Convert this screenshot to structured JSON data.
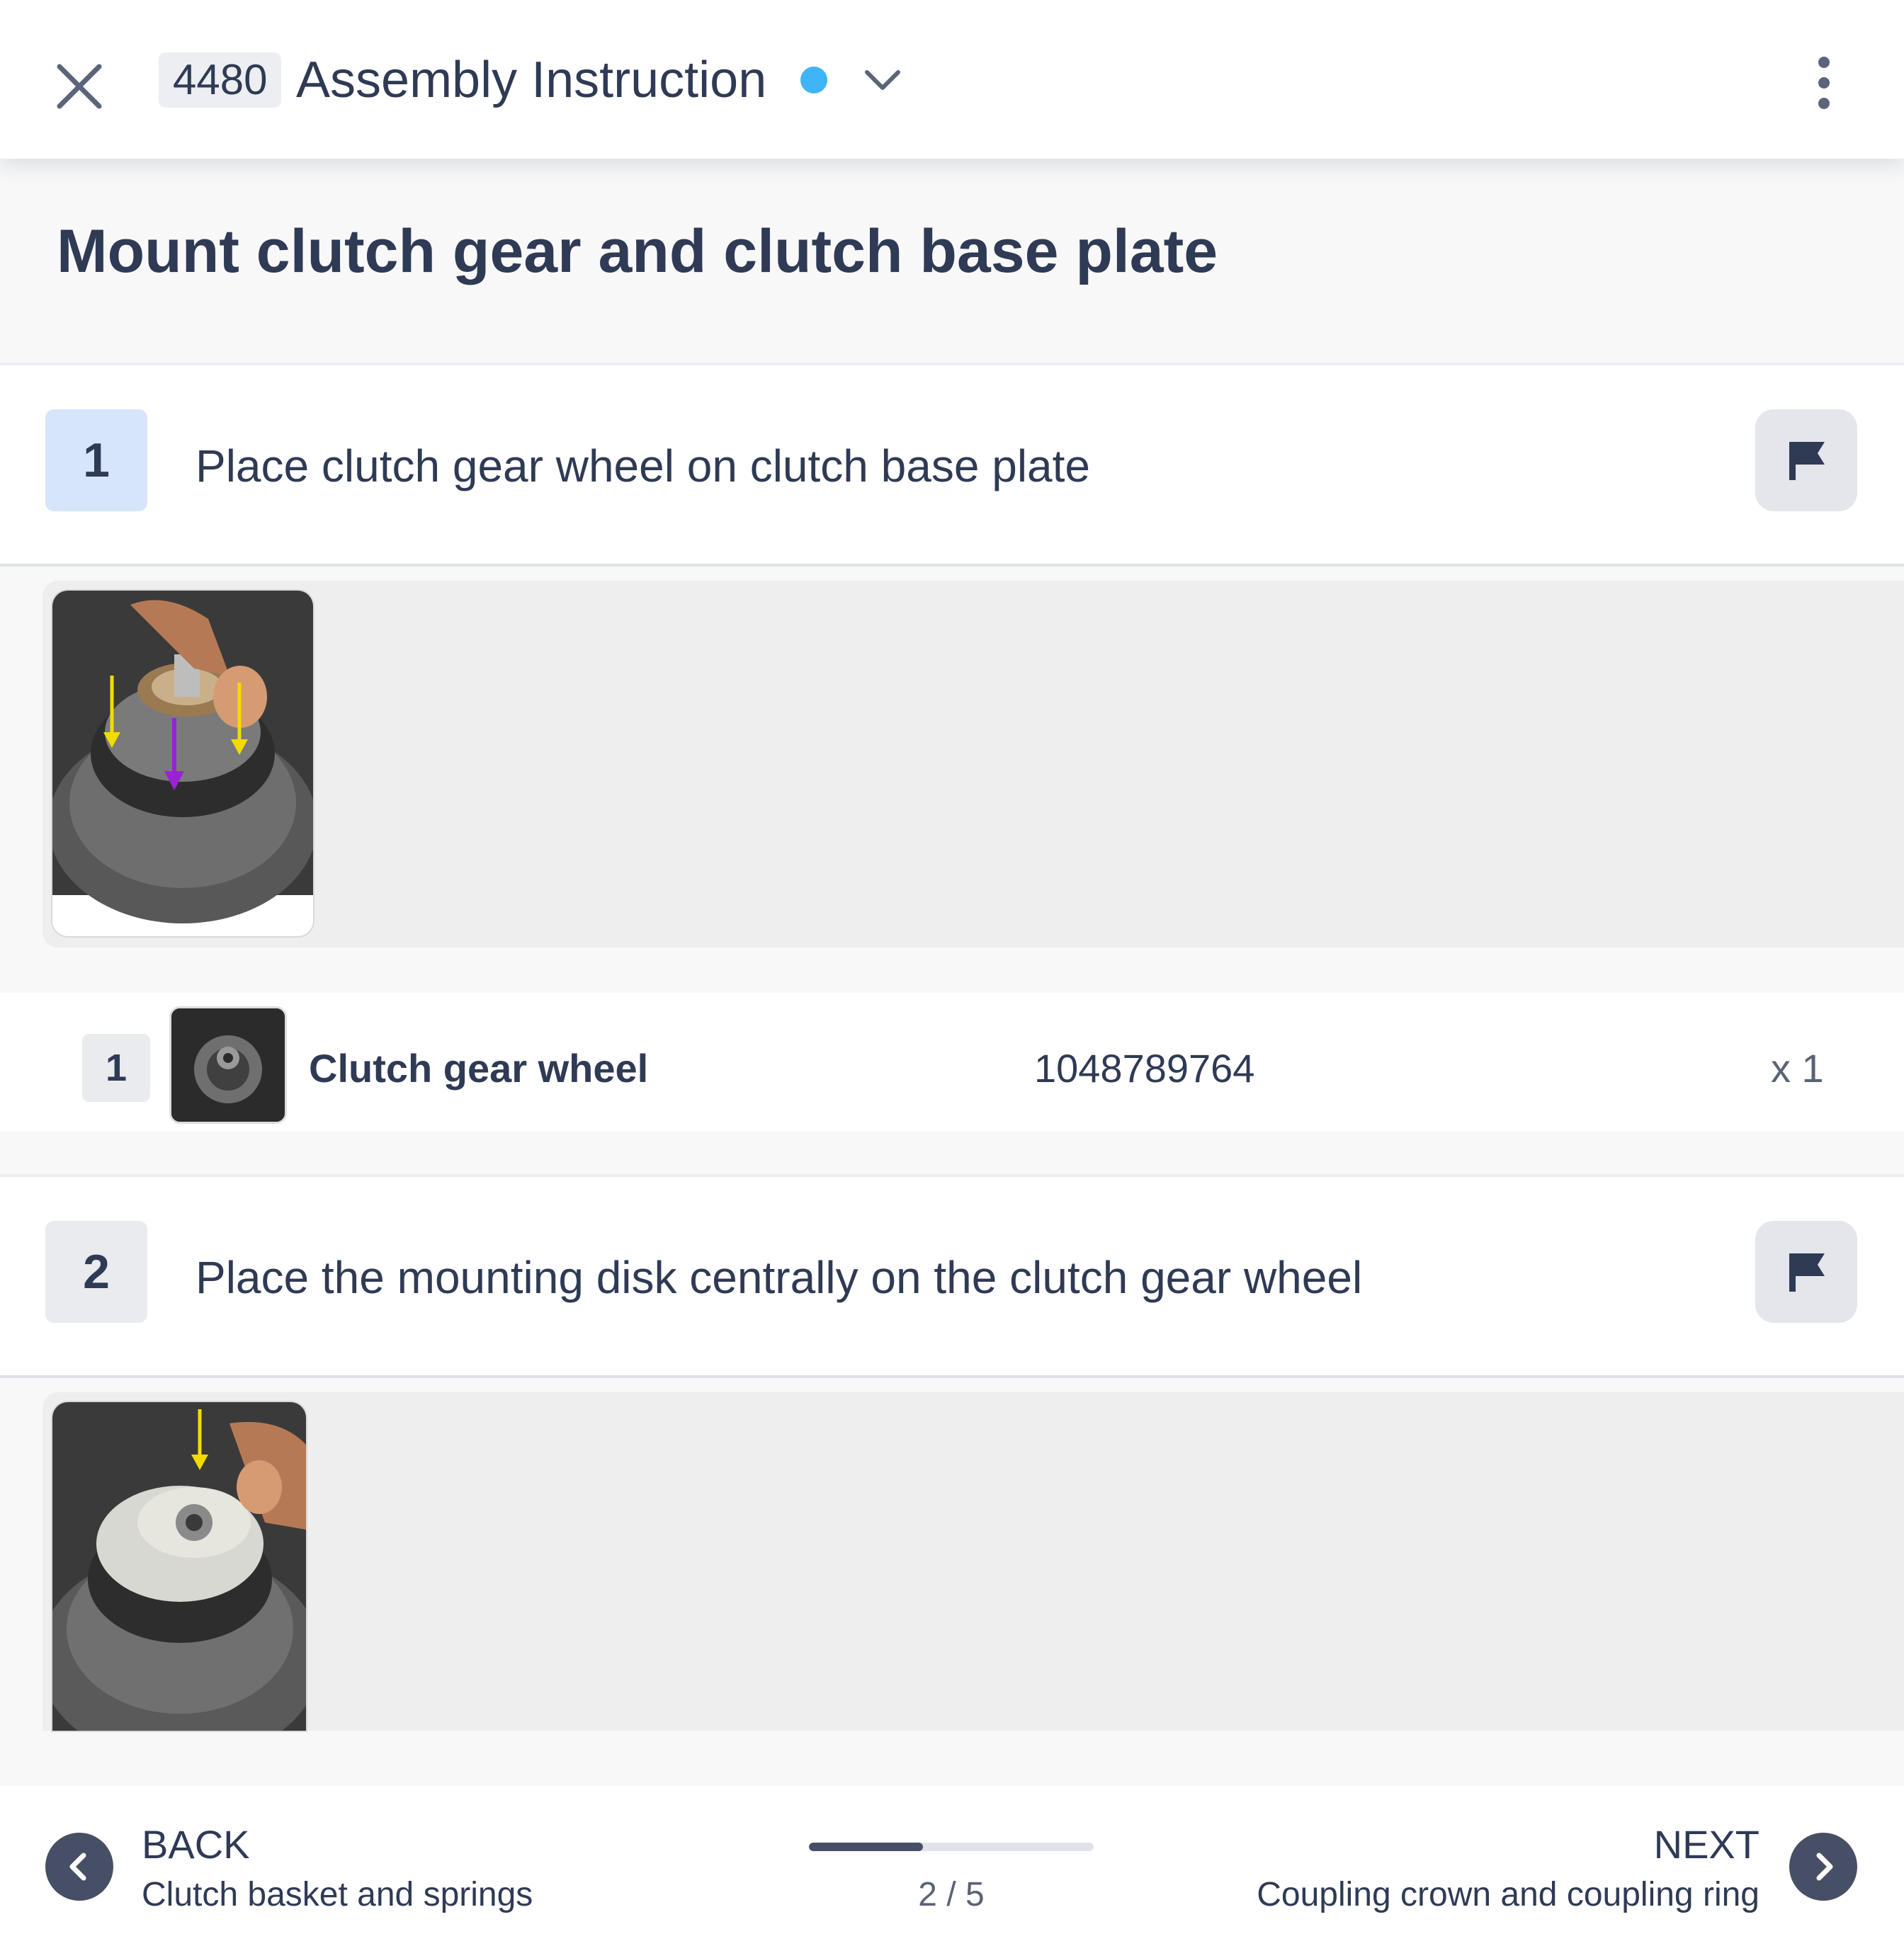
{
  "header": {
    "instruction_id": "4480",
    "title": "Assembly Instruction",
    "status_color": "#3fb4f6",
    "icons": [
      "close-icon",
      "chevron-down-icon",
      "more-vertical-icon"
    ]
  },
  "page": {
    "title": "Mount clutch gear and clutch base plate"
  },
  "steps": [
    {
      "number": "1",
      "text": "Place clutch gear wheel on clutch base plate",
      "flag_icon": "flag-icon",
      "parts": [
        {
          "index": "1",
          "name": "Clutch gear wheel",
          "part_number": "1048789764",
          "quantity": "x 1"
        }
      ]
    },
    {
      "number": "2",
      "text": "Place the mounting disk centrally on the clutch gear wheel",
      "flag_icon": "flag-icon"
    }
  ],
  "footer": {
    "back_label": "BACK",
    "back_subtitle": "Clutch basket and springs",
    "next_label": "NEXT",
    "next_subtitle": "Coupling crown and coupling ring",
    "progress_text": "2 / 5",
    "progress_fraction": 0.4
  }
}
